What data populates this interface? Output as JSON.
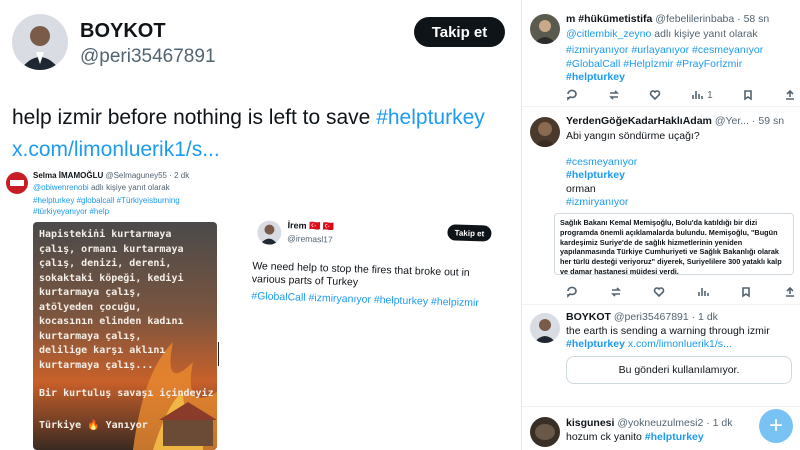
{
  "main": {
    "display_name": "BOYKOT",
    "handle": "@peri35467891",
    "follow_label": "Takip et",
    "tweet_text": "help izmir before nothing is left to save ",
    "tweet_hashtag": "#helpturkey",
    "tweet_link": "x.com/limonluerik1/s...",
    "embedded": {
      "name": "Selma İMAMOĞLU",
      "handle_time": "@Selmaguney55 · 2 dk",
      "reply_handle": "@obiwenrenobi",
      "reply_suffix": " adlı kişiye yanıt olarak",
      "hashtags_line1": "#helpturkey #globalcall #Türkiyeisburning",
      "hashtags_line2": "#türkiyeyanıyor #help",
      "poster_text": "Hapisteki̇ni kurtarmaya çalış, ormanı kurtarmaya çalış, denizi, dereni, sokaktaki köpeği, kediyi kurtarmaya çalış, atölyeden çocuğu, kocasının elinden kadını kurtarmaya çalış, delilige karşı aklını kurtarmaya çalış...",
      "poster_sub": "Bir kurtuluş savaşı içindeyiz",
      "poster_footer": "Türkiye 🔥 Yanıyor"
    },
    "quoted": {
      "name": "İrem",
      "flags": "🇹🇷 🇹🇷",
      "handle": "@iremasl17",
      "follow_label": "Takip et",
      "text": "We need help to stop the fires that broke out in various parts of Turkey",
      "hashtags": "#GlobalCall #izmiryanıyor  #helpturkey #helpizmir"
    }
  },
  "feed": [
    {
      "name": "m #hükümetistifa",
      "handle_time": "@febelilerinbaba · 58 sn",
      "reply_handle": "@citlembik_zeyno",
      "reply_suffix": " adlı kişiye yanıt olarak",
      "hashtags_1": "#izmiryanıyor #urlayanıyor #cesmeyanıyor",
      "hashtags_2": "#GlobalCall #Helpİzmir  #PrayForİzmir",
      "hashtags_3": "#helpturkey",
      "views": "1"
    },
    {
      "name": "YerdenGöğeKadarHaklıAdam",
      "handle_time": "@Yer... · 59 sn",
      "text": "Abi yangın söndürme uçağı?",
      "tag_1": "#cesmeyanıyor",
      "tag_2": "#helpturkey",
      "plain": "orman",
      "tag_3": "#izmiryanıyor",
      "news": "Sağlık Bakanı Kemal Memişoğlu, Bolu'da katıldığı bir dizi programda önemli açıklamalarda bulundu. Memişoğlu, \"Bugün kardeşimiz Suriye'de de sağlık hizmetlerinin yeniden yapılanmasında Türkiye Cumhuriyeti ve Sağlık Bakanlığı olarak her türlü desteği veriyoruz\" diyerek, Suriyelilere 300 yataklı kalp ve damar hastanesi müjdesi verdi."
    },
    {
      "name": "BOYKOT",
      "handle_time": "@peri35467891 · 1 dk",
      "text": "the earth is sending a warning through izmir",
      "tag": "#helpturkey",
      "link": " x.com/limonluerik1/s...",
      "unavailable": "Bu gönderi kullanılamıyor."
    },
    {
      "name": "kisgunesi",
      "handle_time": "@yokneuzulmesi2 · 1 dk",
      "text": "hozum ck yanito ",
      "tag": "#helpturkey"
    }
  ],
  "compose_label": "+"
}
